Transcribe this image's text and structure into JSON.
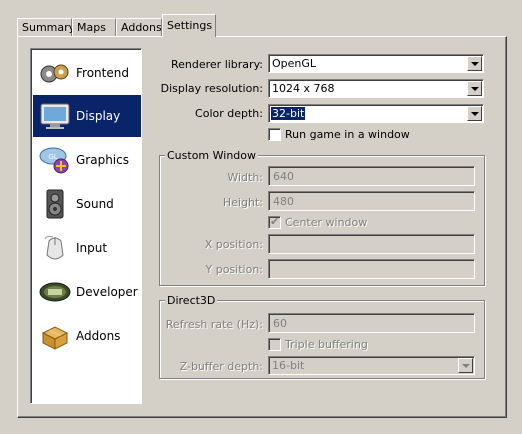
{
  "tabs": [
    {
      "label": "Summary"
    },
    {
      "label": "Maps"
    },
    {
      "label": "Addons"
    },
    {
      "label": "Settings"
    }
  ],
  "categories": [
    {
      "label": "Frontend",
      "icon": "frontend-icon"
    },
    {
      "label": "Display",
      "icon": "display-monitor-icon"
    },
    {
      "label": "Graphics",
      "icon": "opengl-icon"
    },
    {
      "label": "Sound",
      "icon": "speaker-icon"
    },
    {
      "label": "Input",
      "icon": "mouse-icon"
    },
    {
      "label": "Developer",
      "icon": "developer-icon"
    },
    {
      "label": "Addons",
      "icon": "addons-box-icon"
    }
  ],
  "selected_category": "Display",
  "display": {
    "renderer_label": "Renderer library:",
    "renderer_value": "OpenGL",
    "resolution_label": "Display resolution:",
    "resolution_value": "1024 x 768",
    "color_depth_label": "Color depth:",
    "color_depth_value": "32-bit",
    "run_window_label": "Run game in a window",
    "run_window_checked": false
  },
  "custom_window": {
    "title": "Custom Window",
    "width_label": "Width:",
    "width_value": "640",
    "height_label": "Height:",
    "height_value": "480",
    "center_label": "Center window",
    "center_checked": true,
    "xpos_label": "X position:",
    "xpos_value": "",
    "ypos_label": "Y position:",
    "ypos_value": ""
  },
  "direct3d": {
    "title": "Direct3D",
    "refresh_label": "Refresh rate (Hz):",
    "refresh_value": "60",
    "triple_label": "Triple buffering",
    "triple_checked": false,
    "zbuffer_label": "Z-buffer depth:",
    "zbuffer_value": "16-bit"
  },
  "colors": {
    "face": "#d4d0c8",
    "selection": "#0a246a",
    "disabled_text": "#808080"
  }
}
